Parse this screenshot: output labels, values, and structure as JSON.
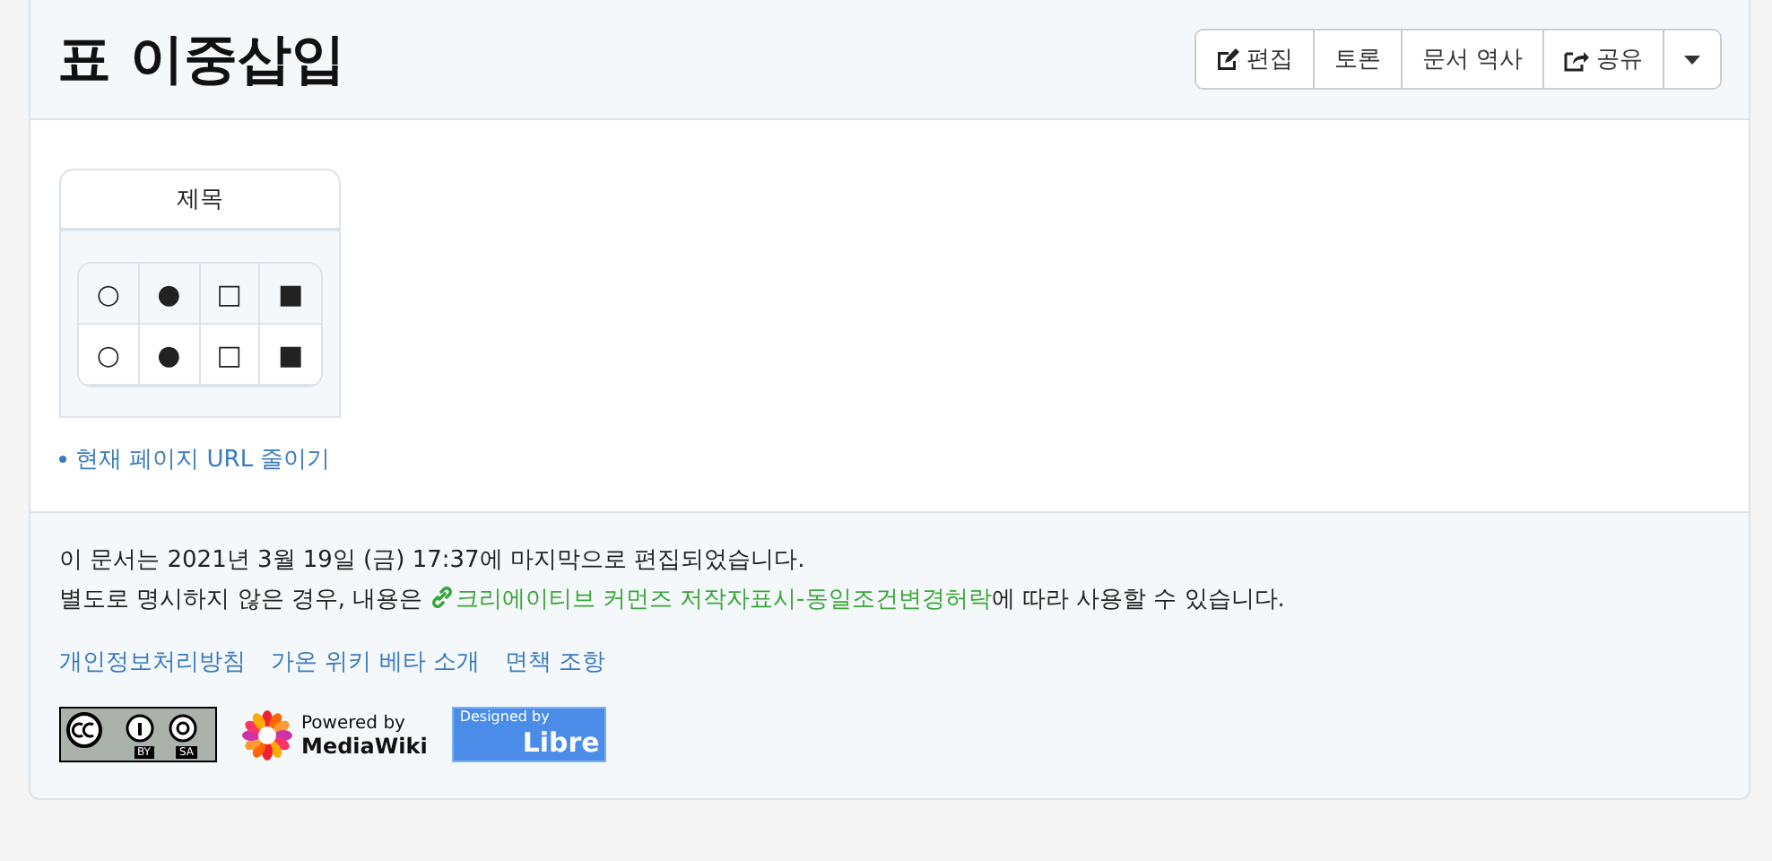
{
  "title": "표 이중삽입",
  "actions": [
    {
      "kind": "edit",
      "label": "편집"
    },
    {
      "kind": "plain",
      "label": "토론"
    },
    {
      "kind": "plain",
      "label": "문서 역사"
    },
    {
      "kind": "share",
      "label": "공유"
    },
    {
      "kind": "caret"
    }
  ],
  "infobox": {
    "title": "제목",
    "rows": [
      [
        "○",
        "●",
        "□",
        "■"
      ],
      [
        "○",
        "●",
        "□",
        "■"
      ]
    ]
  },
  "shorten_link": "현재 페이지 URL 줄이기",
  "footer": {
    "modified": "이 문서는 2021년 3월 19일 (금) 17:37에 마지막으로 편집되었습니다.",
    "license_before": "별도로 명시하지 않은 경우, 내용은 ",
    "license_link": "크리에이티브 커먼즈 저작자표시-동일조건변경허락",
    "license_after": "에 따라 사용할 수 있습니다.",
    "links": [
      "개인정보처리방침",
      "가온 위키 베타 소개",
      "면책 조항"
    ],
    "badges": {
      "cc": [
        "BY",
        "SA"
      ],
      "mediawiki": [
        "Powered by",
        "MediaWiki"
      ],
      "libre": [
        "Designed by",
        "Libre"
      ]
    }
  }
}
